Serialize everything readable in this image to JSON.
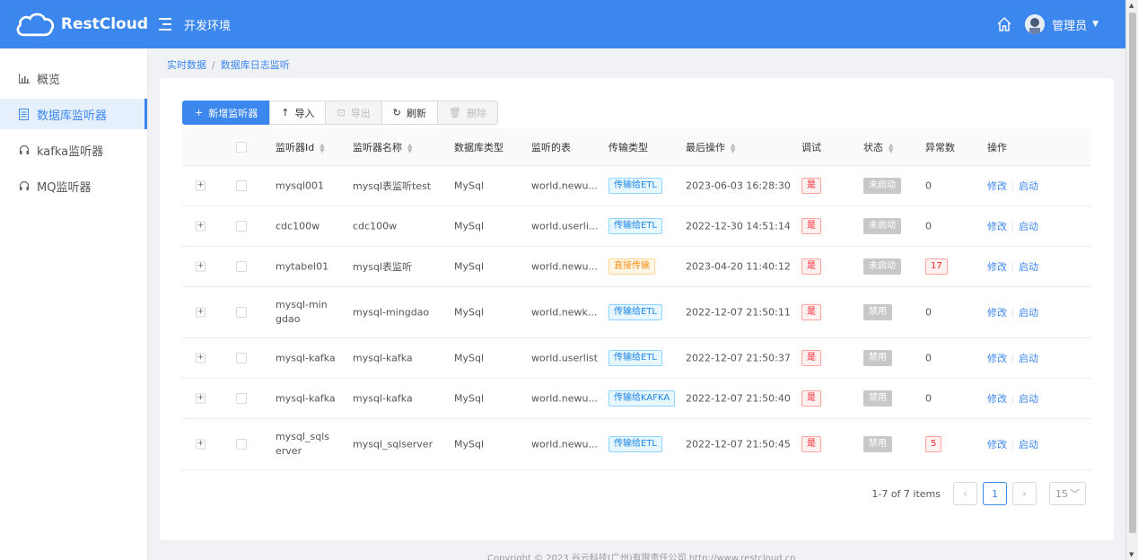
{
  "app": {
    "brand": "RestCloud",
    "env_title": "开发环境",
    "user": "管理员"
  },
  "sidebar": {
    "items": [
      {
        "label": "概览",
        "icon": "bar-chart-icon"
      },
      {
        "label": "数据库监听器",
        "icon": "database-icon",
        "active": true
      },
      {
        "label": "kafka监听器",
        "icon": "headset-icon"
      },
      {
        "label": "MQ监听器",
        "icon": "headset-icon"
      }
    ]
  },
  "breadcrumb": [
    "实时数据",
    "数据库日志监听"
  ],
  "toolbar": {
    "add": "新增监听器",
    "import": "导入",
    "export": "导出",
    "refresh": "刷新",
    "delete": "删除"
  },
  "table": {
    "columns": [
      "监听器Id",
      "监听器名称",
      "数据库类型",
      "监听的表",
      "传输类型",
      "最后操作",
      "调试",
      "状态",
      "异常数",
      "操作"
    ],
    "rows": [
      {
        "id": "mysql001",
        "name": "mysql表监听test",
        "db": "MySql",
        "table": "world.newu...",
        "transfer": "传输给ETL",
        "tcolor": "blue",
        "last": "2023-06-03 16:28:30",
        "debug": "是",
        "status": "未启动",
        "errors": "0",
        "err_badge": false,
        "edit": "修改",
        "start": "启动"
      },
      {
        "id": "cdc100w",
        "name": "cdc100w",
        "db": "MySql",
        "table": "world.userli...",
        "transfer": "传输给ETL",
        "tcolor": "blue",
        "last": "2022-12-30 14:51:14",
        "debug": "是",
        "status": "未启动",
        "errors": "0",
        "err_badge": false,
        "edit": "修改",
        "start": "启动"
      },
      {
        "id": "mytabel01",
        "name": "mysql表监听",
        "db": "MySql",
        "table": "world.newu...",
        "transfer": "直接传输",
        "tcolor": "orange",
        "last": "2023-04-20 11:40:12",
        "debug": "是",
        "status": "未启动",
        "errors": "17",
        "err_badge": true,
        "edit": "修改",
        "start": "启动"
      },
      {
        "id": "mysql-mingdao",
        "name": "mysql-mingdao",
        "db": "MySql",
        "table": "world.newk...",
        "transfer": "传输给ETL",
        "tcolor": "blue",
        "last": "2022-12-07 21:50:11",
        "debug": "是",
        "status": "禁用",
        "errors": "0",
        "err_badge": false,
        "edit": "修改",
        "start": "启动"
      },
      {
        "id": "mysql-kafka",
        "name": "mysql-kafka",
        "db": "MySql",
        "table": "world.userlist",
        "transfer": "传输给ETL",
        "tcolor": "blue",
        "last": "2022-12-07 21:50:37",
        "debug": "是",
        "status": "禁用",
        "errors": "0",
        "err_badge": false,
        "edit": "修改",
        "start": "启动"
      },
      {
        "id": "mysql-kafka",
        "name": "mysql-kafka",
        "db": "MySql",
        "table": "world.newu...",
        "transfer": "传输给KAFKA",
        "tcolor": "blue",
        "last": "2022-12-07 21:50:40",
        "debug": "是",
        "status": "禁用",
        "errors": "0",
        "err_badge": false,
        "edit": "修改",
        "start": "启动"
      },
      {
        "id": "mysql_sqlserver",
        "name": "mysql_sqlserver",
        "db": "MySql",
        "table": "world.newu...",
        "transfer": "传输给ETL",
        "tcolor": "blue",
        "last": "2022-12-07 21:50:45",
        "debug": "是",
        "status": "禁用",
        "errors": "5",
        "err_badge": true,
        "edit": "修改",
        "start": "启动"
      }
    ]
  },
  "pagination": {
    "total": "1-7 of 7 items",
    "current": "1",
    "page_size": "15"
  },
  "footer": "Copyright © 2023    谷云科技(广州)有限责任公司    http://www.restcloud.cn",
  "colors": {
    "primary": "#3c87ee"
  }
}
